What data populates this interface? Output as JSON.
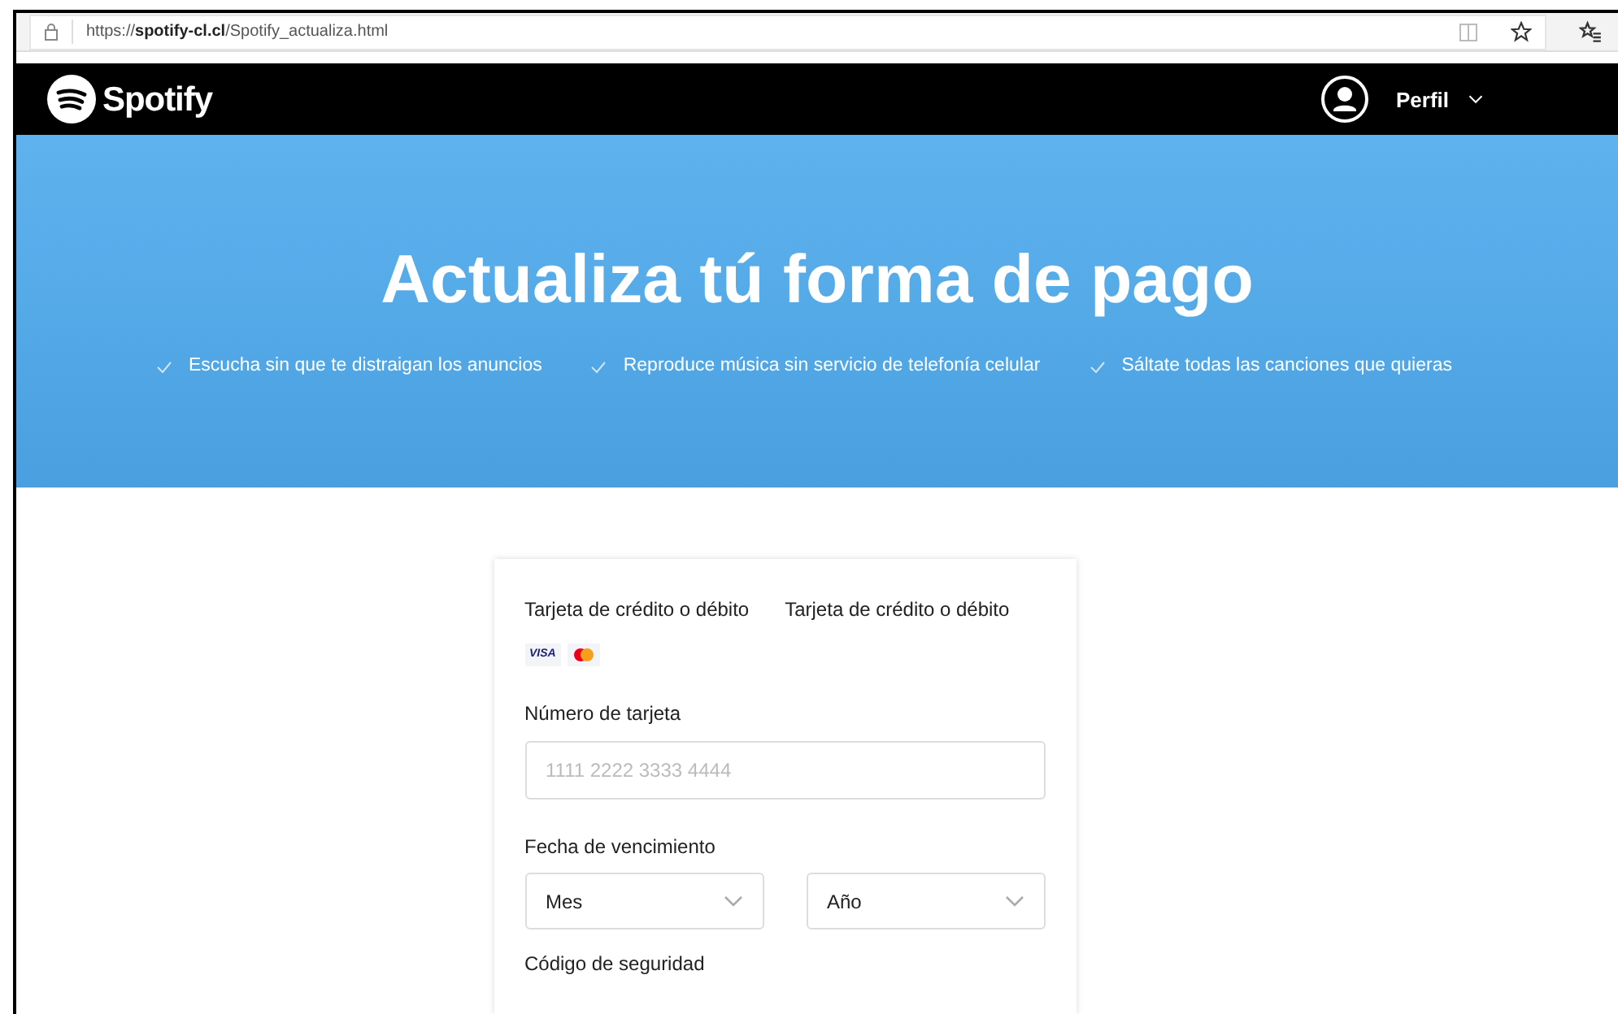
{
  "browser": {
    "url_prefix": "https://",
    "url_host": "spotify-cl.cl",
    "url_path": "/Spotify_actualiza.html"
  },
  "navbar": {
    "logo": "Spotify",
    "profile": "Perfil"
  },
  "hero": {
    "title": "Actualiza tú forma de pago",
    "benefits": [
      "Escucha sin que te distraigan los anuncios",
      "Reproduce música sin servicio de telefonía celular",
      "Sáltate todas las canciones que quieras"
    ]
  },
  "form": {
    "options": [
      "Tarjeta de crédito o débito",
      "Tarjeta de crédito o débito"
    ],
    "visa": "VISA",
    "card_number": {
      "label": "Número de tarjeta",
      "placeholder": "1111 2222 3333 4444"
    },
    "expiry": {
      "label": "Fecha de vencimiento",
      "month": "Mes",
      "year": "Año"
    },
    "security_label": "Código de seguridad"
  }
}
